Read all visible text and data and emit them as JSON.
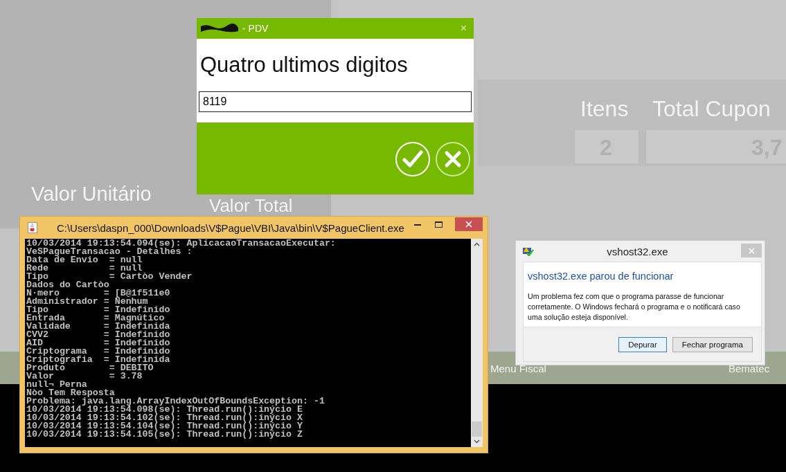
{
  "background_app": {
    "labels": [
      {
        "kind": "header",
        "text": "Itens"
      },
      {
        "kind": "header",
        "text": "Total Cupon"
      },
      {
        "kind": "value",
        "text": "2"
      },
      {
        "kind": "value",
        "text": "3,7"
      },
      {
        "kind": "column",
        "text": "Valor Unitário"
      },
      {
        "kind": "column",
        "text": "Valor Total"
      },
      {
        "kind": "footer",
        "text": "Menu Fiscal"
      },
      {
        "kind": "footer",
        "text": "Bematec"
      }
    ]
  },
  "pdv_dialog": {
    "title": "- PDV",
    "close": "×",
    "prompt": "Quatro ultimos digitos",
    "input_value": "8119"
  },
  "console_window": {
    "title": "C:\\Users\\daspn_000\\Downloads\\V$Pague\\VBI\\Java\\bin\\V$PagueClient.exe",
    "lines": [
      "10/03/2014 19:13:54.094(se): AplicacaoTransacaoExecutar:",
      "VeSPagueTransacao - Detalhes :",
      "Data de Envio  = null",
      "Rede           = null",
      "Tipo           = Cartòo Vender",
      "Dados do Cartòo",
      "N·mero        = [B@1f511e0",
      "Administrador = Nenhum",
      "Tipo          = Indefinido",
      "Entrada       = Magnútico",
      "Validade      = Indefinida",
      "CVV2          = Indefinido",
      "AID           = Indefinido",
      "Criptograma   = Indefinido",
      "Criptografia  = Indefinida",
      "Produto        = DEBITO",
      "Valor          = 3.78",
      "null¬ Perna",
      "Nòo Tem Resposta",
      "Problema: java.lang.ArrayIndexOutOfBoundsException: -1",
      "10/03/2014 19:13:54.098(se): Thread.run():inýcio E",
      "10/03/2014 19:13:54.102(se): Thread.run():inýcio X",
      "10/03/2014 19:13:54.104(se): Thread.run():inýcio Y",
      "10/03/2014 19:13:54.105(se): Thread.run():inýcio Z"
    ]
  },
  "error_dialog": {
    "title": "vshost32.exe",
    "heading": "vshost32.exe parou de funcionar",
    "message": "Um problema fez com que o programa parasse de funcionar corretamente. O Windows fechará o programa e o notificará caso uma solução esteja disponível.",
    "buttons": [
      {
        "label": "Depurar",
        "selected": true
      },
      {
        "label": "Fechar programa",
        "selected": false
      }
    ]
  }
}
